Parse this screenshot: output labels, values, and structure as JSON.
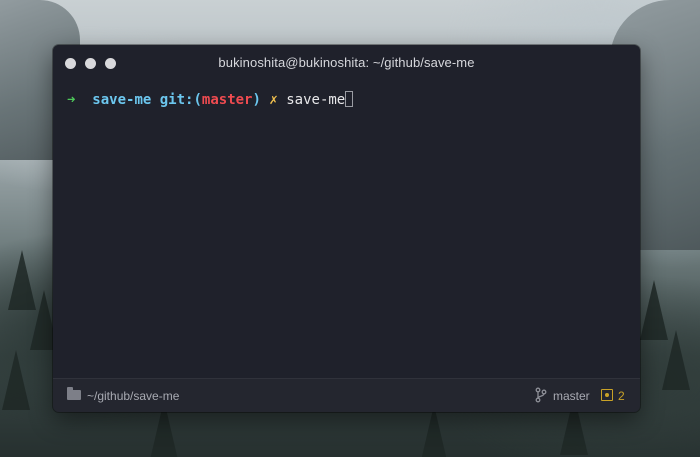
{
  "window": {
    "title": "bukinoshita@bukinoshita: ~/github/save-me"
  },
  "terminal": {
    "prompt_arrow": "➜",
    "directory": "save-me",
    "git_label": "git:",
    "open_paren": "(",
    "branch": "master",
    "close_paren": ")",
    "dirty_marker": "✗",
    "command": "save-me"
  },
  "statusbar": {
    "path": "~/github/save-me",
    "branch": "master",
    "changes_count": "2"
  },
  "colors": {
    "terminal_background": "#1f212b",
    "prompt_arrow": "#4ec95a",
    "prompt_directory": "#6cc7ef",
    "prompt_branch": "#ef4b50",
    "dirty_marker": "#f2c14e",
    "changes_badge": "#c9a227"
  },
  "icons": {
    "folder": "folder-icon",
    "branch": "git-branch-icon",
    "changes": "modified-files-icon"
  }
}
